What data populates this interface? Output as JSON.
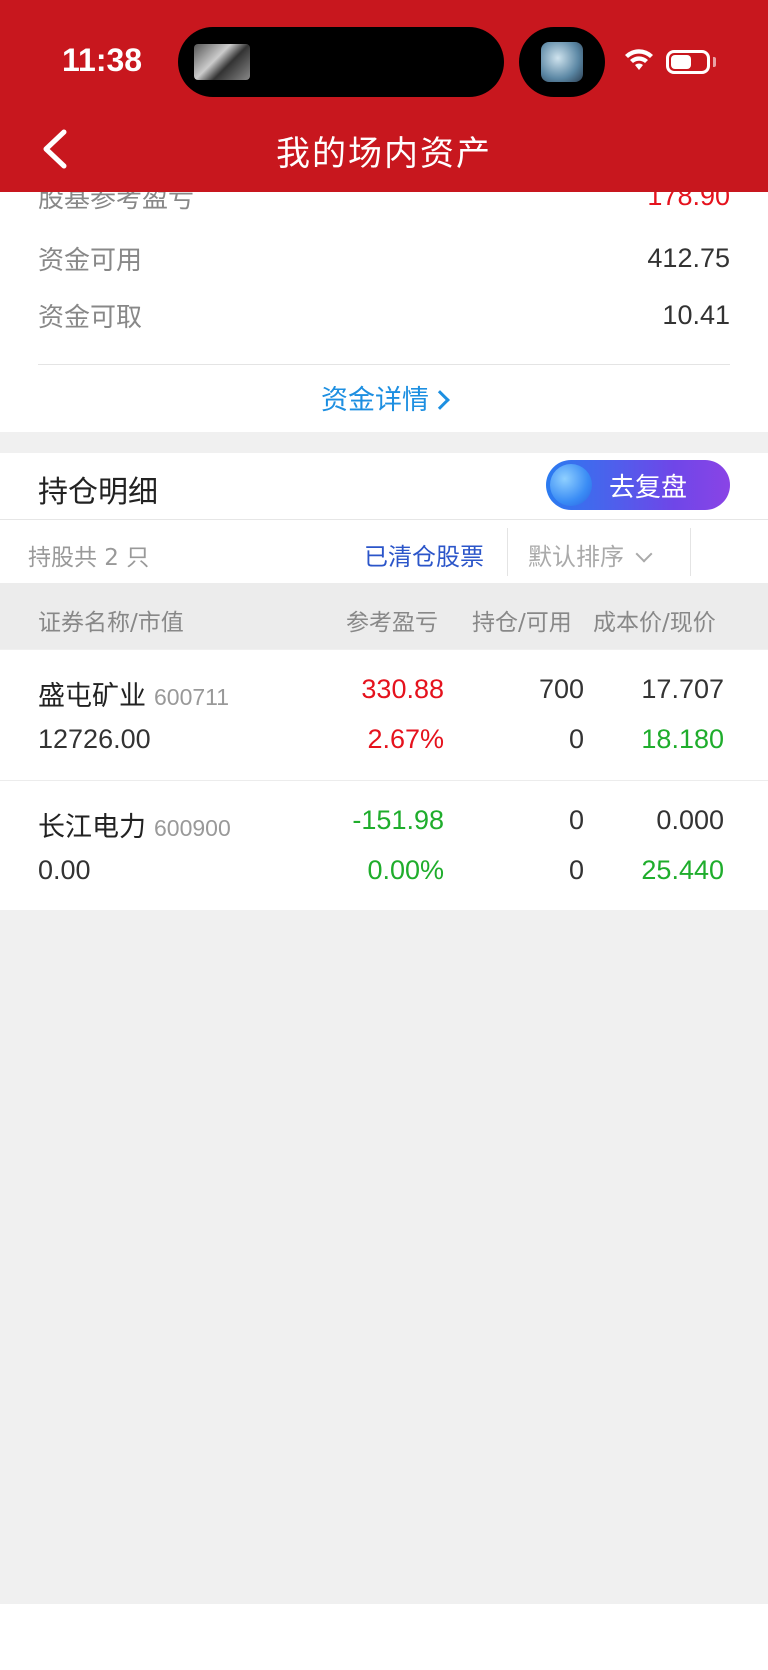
{
  "status_bar": {
    "time": "11:38"
  },
  "nav": {
    "title": "我的场内资产"
  },
  "funds": {
    "rows": [
      {
        "label": "股基参考盈亏",
        "value": "178.90"
      },
      {
        "label": "资金可用",
        "value": "412.75"
      },
      {
        "label": "资金可取",
        "value": "10.41"
      }
    ],
    "detail_link": "资金详情"
  },
  "holdings": {
    "title": "持仓明细",
    "review_button": "去复盘",
    "count_text": "持股共 2 只",
    "cleared_link": "已清仓股票",
    "sort_label": "默认排序",
    "columns": [
      "证券名称/市值",
      "参考盈亏",
      "持仓/可用",
      "成本价/现价"
    ],
    "items": [
      {
        "name": "盛屯矿业",
        "code": "600711",
        "market_value": "12726.00",
        "pnl": "330.88",
        "pnl_pct": "2.67%",
        "position": "700",
        "available": "0",
        "cost": "17.707",
        "price": "18.180"
      },
      {
        "name": "长江电力",
        "code": "600900",
        "market_value": "0.00",
        "pnl": "-151.98",
        "pnl_pct": "0.00%",
        "position": "0",
        "available": "0",
        "cost": "0.000",
        "price": "25.440"
      }
    ]
  },
  "colors": {
    "header_red": "#c8171e",
    "gain_red": "#e5121d",
    "loss_green": "#1fad2c",
    "link_blue": "#1d8fe1"
  }
}
